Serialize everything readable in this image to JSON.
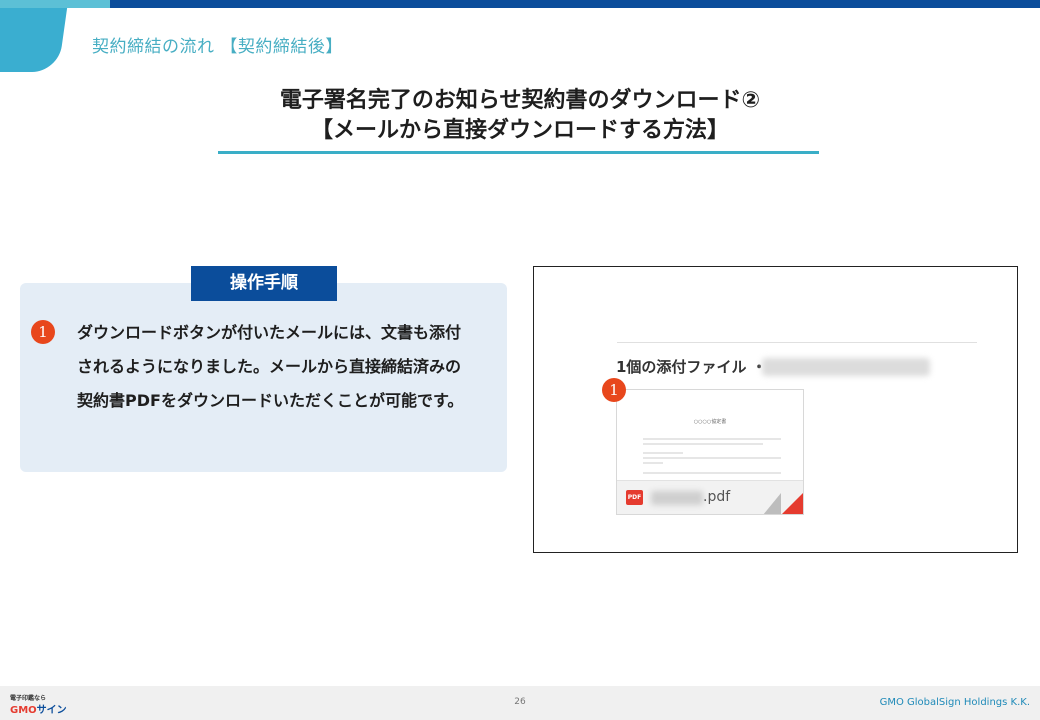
{
  "header": {
    "breadcrumb": "契約締結の流れ 【契約締結後】",
    "title_line1": "電子署名完了のお知らせ契約書のダウンロード②",
    "title_line2": "【メールから直接ダウンロードする方法】"
  },
  "procedure": {
    "tab_label": "操作手順",
    "step_number": "1",
    "step_text": "ダウンロードボタンが付いたメールには、文書も添付されるようになりました。メールから直接締結済みの契約書PDFをダウンロードいただくことが可能です。"
  },
  "screenshot": {
    "attachment_label": "1個の添付ファイル ・",
    "step_number": "1",
    "doc_title": "○○○○協定書",
    "pdf_badge": "PDF",
    "file_ext": ".pdf"
  },
  "footer": {
    "brand_top": "電子印鑑なら",
    "brand_gmo": "GMO",
    "brand_sign": "サイン",
    "page_number": "26",
    "company": "GMO GlobalSign Holdings K.K."
  }
}
